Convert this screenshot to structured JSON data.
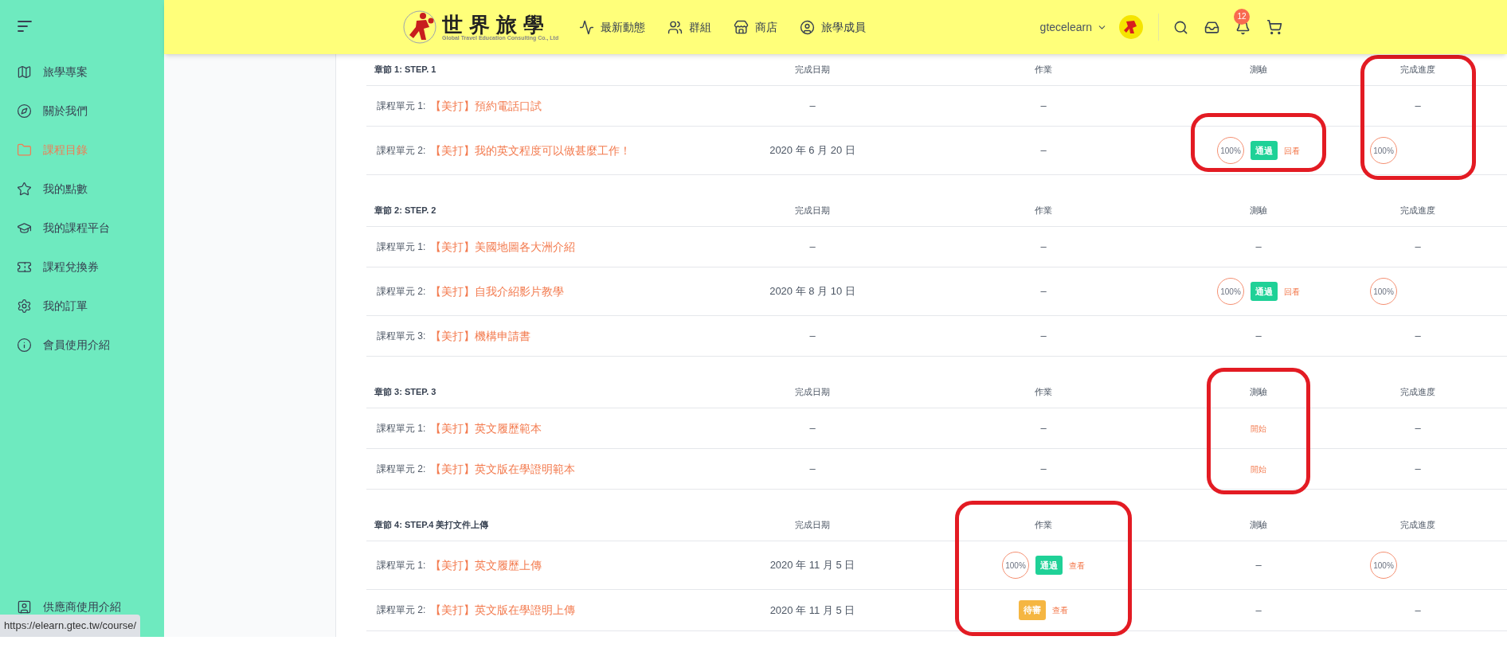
{
  "sidebar": {
    "items": [
      {
        "label": "旅學專案",
        "selected": false
      },
      {
        "label": "關於我們",
        "selected": false
      },
      {
        "label": "課程目錄",
        "selected": true
      },
      {
        "label": "我的點數",
        "selected": false
      },
      {
        "label": "我的課程平台",
        "selected": false
      },
      {
        "label": "課程兌換券",
        "selected": false
      },
      {
        "label": "我的訂單",
        "selected": false
      },
      {
        "label": "會員使用介紹",
        "selected": false
      }
    ],
    "bottom_item": {
      "label": "供應商使用介紹",
      "selected": false
    }
  },
  "status_url": "https://elearn.gtec.tw/course/",
  "header": {
    "logo": {
      "title": "世界旅學",
      "subtitle": "Global Travel Education Consulting Co., Ltd"
    },
    "nav": [
      "最新動態",
      "群組",
      "商店",
      "旅學成員"
    ],
    "username": "gtecelearn",
    "notification_count": "12"
  },
  "chapters": [
    {
      "title": "章節 1: STEP. 1",
      "headers": [
        {
          "label": "完成日期",
          "kind": "plain"
        },
        {
          "label": "作業",
          "kind": "plain"
        },
        {
          "label": "測驗",
          "kind": "plain"
        },
        {
          "label": "完成進度",
          "kind": "circled"
        }
      ],
      "units": [
        {
          "label": "課程單元 1:",
          "name": "【美打】預約電話口試",
          "date": {
            "kind": "text",
            "text": "–"
          },
          "homework": {
            "kind": "text",
            "text": "–"
          },
          "quiz": {
            "kind": "empty"
          },
          "progress": {
            "kind": "text",
            "text": "–"
          }
        },
        {
          "label": "課程單元 2:",
          "name": "【美打】我的英文程度可以做甚麼工作！",
          "date": {
            "kind": "text",
            "text": "2020 年 6 月 20 日"
          },
          "homework": {
            "kind": "text",
            "text": "–"
          },
          "quiz": {
            "kind": "circled_result",
            "percent": "100%",
            "badge": {
              "text": "通過",
              "kind": "pass"
            },
            "link": "回看"
          },
          "progress": {
            "kind": "percent",
            "text": "100%"
          }
        }
      ]
    },
    {
      "title": "章節 2: STEP. 2",
      "headers": [
        {
          "label": "完成日期",
          "kind": "plain"
        },
        {
          "label": "作業",
          "kind": "plain"
        },
        {
          "label": "測驗",
          "kind": "plain"
        },
        {
          "label": "完成進度",
          "kind": "plain"
        }
      ],
      "units": [
        {
          "label": "課程單元 1:",
          "name": "【美打】美國地圖各大洲介紹",
          "date": {
            "kind": "text",
            "text": "–"
          },
          "homework": {
            "kind": "text",
            "text": "–"
          },
          "quiz": {
            "kind": "text",
            "text": "–"
          },
          "progress": {
            "kind": "text",
            "text": "–"
          }
        },
        {
          "label": "課程單元 2:",
          "name": "【美打】自我介紹影片教學",
          "date": {
            "kind": "text",
            "text": "2020 年 8 月 10 日"
          },
          "homework": {
            "kind": "text",
            "text": "–"
          },
          "quiz": {
            "kind": "result",
            "percent": "100%",
            "badge": {
              "text": "通過",
              "kind": "pass"
            },
            "link": "回看"
          },
          "progress": {
            "kind": "percent",
            "text": "100%"
          }
        },
        {
          "label": "課程單元 3:",
          "name": "【美打】機構申請書",
          "date": {
            "kind": "text",
            "text": "–"
          },
          "homework": {
            "kind": "text",
            "text": "–"
          },
          "quiz": {
            "kind": "text",
            "text": "–"
          },
          "progress": {
            "kind": "text",
            "text": "–"
          }
        }
      ]
    },
    {
      "title": "章節 3: STEP. 3",
      "headers": [
        {
          "label": "完成日期",
          "kind": "plain"
        },
        {
          "label": "作業",
          "kind": "plain"
        },
        {
          "label": "測驗",
          "kind": "circled"
        },
        {
          "label": "完成進度",
          "kind": "plain"
        }
      ],
      "units": [
        {
          "label": "課程單元 1:",
          "name": "【美打】英文履歷範本",
          "date": {
            "kind": "text",
            "text": "–"
          },
          "homework": {
            "kind": "text",
            "text": "–"
          },
          "quiz": {
            "kind": "link",
            "text": "開始"
          },
          "progress": {
            "kind": "text",
            "text": "–"
          }
        },
        {
          "label": "課程單元 2:",
          "name": "【美打】英文版在學證明範本",
          "date": {
            "kind": "text",
            "text": "–"
          },
          "homework": {
            "kind": "text",
            "text": "–"
          },
          "quiz": {
            "kind": "link",
            "text": "開始"
          },
          "progress": {
            "kind": "text",
            "text": "–"
          }
        }
      ]
    },
    {
      "title": "章節 4: STEP.4 美打文件上傳",
      "headers": [
        {
          "label": "完成日期",
          "kind": "plain"
        },
        {
          "label": "作業",
          "kind": "circled"
        },
        {
          "label": "測驗",
          "kind": "plain"
        },
        {
          "label": "完成進度",
          "kind": "plain"
        }
      ],
      "units": [
        {
          "label": "課程單元 1:",
          "name": "【美打】英文履歷上傳",
          "date": {
            "kind": "text",
            "text": "2020 年 11 月 5 日"
          },
          "homework": {
            "kind": "result",
            "percent": "100%",
            "badge": {
              "text": "通過",
              "kind": "pass"
            },
            "link": "查看"
          },
          "quiz": {
            "kind": "text",
            "text": "–"
          },
          "progress": {
            "kind": "percent",
            "text": "100%"
          }
        },
        {
          "label": "課程單元 2:",
          "name": "【美打】英文版在學證明上傳",
          "date": {
            "kind": "text",
            "text": "2020 年 11 月 5 日"
          },
          "homework": {
            "kind": "result",
            "badge": {
              "text": "待審",
              "kind": "pending"
            },
            "link": "查看"
          },
          "quiz": {
            "kind": "text",
            "text": "–"
          },
          "progress": {
            "kind": "text",
            "text": "–"
          }
        }
      ]
    }
  ]
}
